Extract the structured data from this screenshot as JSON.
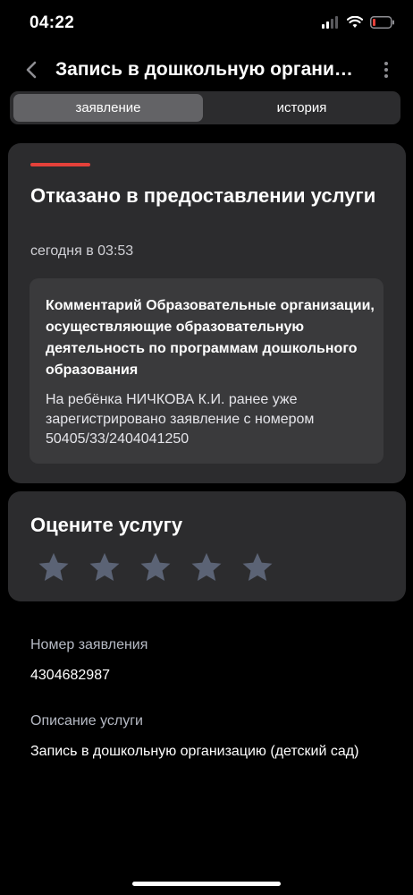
{
  "status_bar": {
    "time": "04:22"
  },
  "header": {
    "title": "Запись в дошкольную организацию (детский сад)"
  },
  "tabs": [
    {
      "label": "заявление",
      "active": true
    },
    {
      "label": "история",
      "active": false
    }
  ],
  "application_status": {
    "title": "Отказано в предоставлении услуги",
    "time": "сегодня в 03:53",
    "accent_color": "#e5413a",
    "comment_title": "Комментарий Образовательные организации, осуществляющие образовательную деятельность по программам дошкольного образования",
    "comment_text": "На ребёнка НИЧКОВА К.И. ранее уже зарегистрировано заявление с номером 50405/33/2404041250"
  },
  "rating": {
    "title": "Оцените услугу",
    "max_stars": 5,
    "selected_stars": 0
  },
  "details": {
    "number_label": "Номер заявления",
    "number_value": "4304682987",
    "description_label": "Описание услуги",
    "description_value": "Запись в дошкольную организацию (детский сад)"
  }
}
